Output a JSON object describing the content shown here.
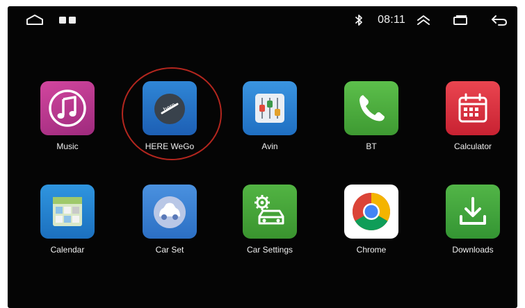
{
  "status_bar": {
    "time": "08:11",
    "icons": [
      "home-outline-icon",
      "recent-apps-icon",
      "bluetooth-icon",
      "expand-up-icon",
      "window-icon",
      "back-icon"
    ]
  },
  "apps": [
    {
      "label": "Music",
      "icon": "music-note-icon",
      "color": "#c2348f"
    },
    {
      "label": "HERE WeGo",
      "icon": "here-wego-icon",
      "color": "#1f73c9",
      "highlighted": true
    },
    {
      "label": "Avin",
      "icon": "avin-equalizer-icon",
      "color": "#2b86d8"
    },
    {
      "label": "BT",
      "icon": "phone-handset-icon",
      "color": "#4cae3d"
    },
    {
      "label": "Calculator",
      "icon": "calendar-grid-icon",
      "color": "#e0323e"
    },
    {
      "label": "Calendar",
      "icon": "calendar-map-icon",
      "color": "#1f88d4"
    },
    {
      "label": "Car Set",
      "icon": "car-set-icon",
      "color": "#3f86d8"
    },
    {
      "label": "Car Settings",
      "icon": "car-gear-icon",
      "color": "#45a83a"
    },
    {
      "label": "Chrome",
      "icon": "chrome-logo-icon",
      "color": "#ffffff"
    },
    {
      "label": "Downloads",
      "icon": "download-arrow-icon",
      "color": "#3fa840"
    }
  ],
  "colors": {
    "background": "#050505",
    "text": "#f0f0f0",
    "highlight_ring": "#b3261e"
  }
}
